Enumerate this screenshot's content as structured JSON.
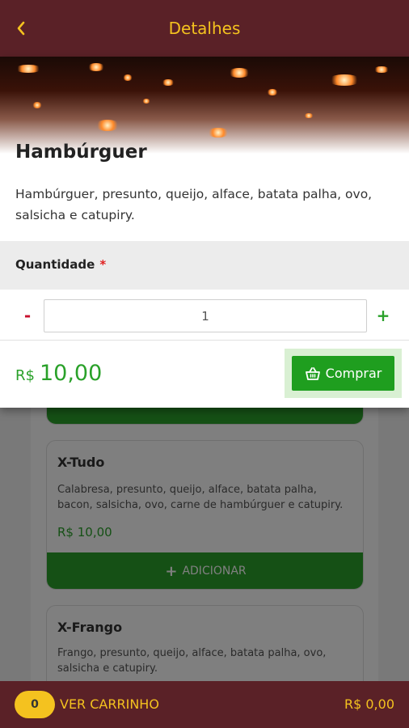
{
  "header": {
    "title": "Detalhes"
  },
  "product": {
    "title": "Hambúrguer",
    "description": "Hambúrguer, presunto, queijo, alface, batata palha, ovo, salsicha e catupiry."
  },
  "quantity": {
    "label": "Quantidade",
    "required_mark": "*",
    "value": "1",
    "decrement_label": "-",
    "increment_label": "+"
  },
  "total": {
    "currency": "R$",
    "value": "10,00"
  },
  "buy_button": {
    "label": "Comprar"
  },
  "background_list": {
    "items": [
      {
        "title": "X-Tudo",
        "description": "Calabresa, presunto, queijo, alface, batata palha, bacon, salsicha, ovo, carne de hambúrguer e catupiry.",
        "price": "R$ 10,00",
        "add_label": "ADICIONAR"
      },
      {
        "title": "X-Frango",
        "description": "Frango, presunto, queijo, alface, batata palha, ovo, salsicha e catupiry."
      }
    ]
  },
  "bottom_bar": {
    "cart_count": "0",
    "cart_label": "VER CARRINHO",
    "cart_total": "R$ 0,00"
  },
  "colors": {
    "header_bg": "#5a2127",
    "accent_yellow": "#f4c21f",
    "green": "#2aa12a",
    "minus_red": "#c8102e"
  },
  "icons": {
    "back": "chevron-left-icon",
    "basket": "basket-icon",
    "add": "plus-icon"
  }
}
